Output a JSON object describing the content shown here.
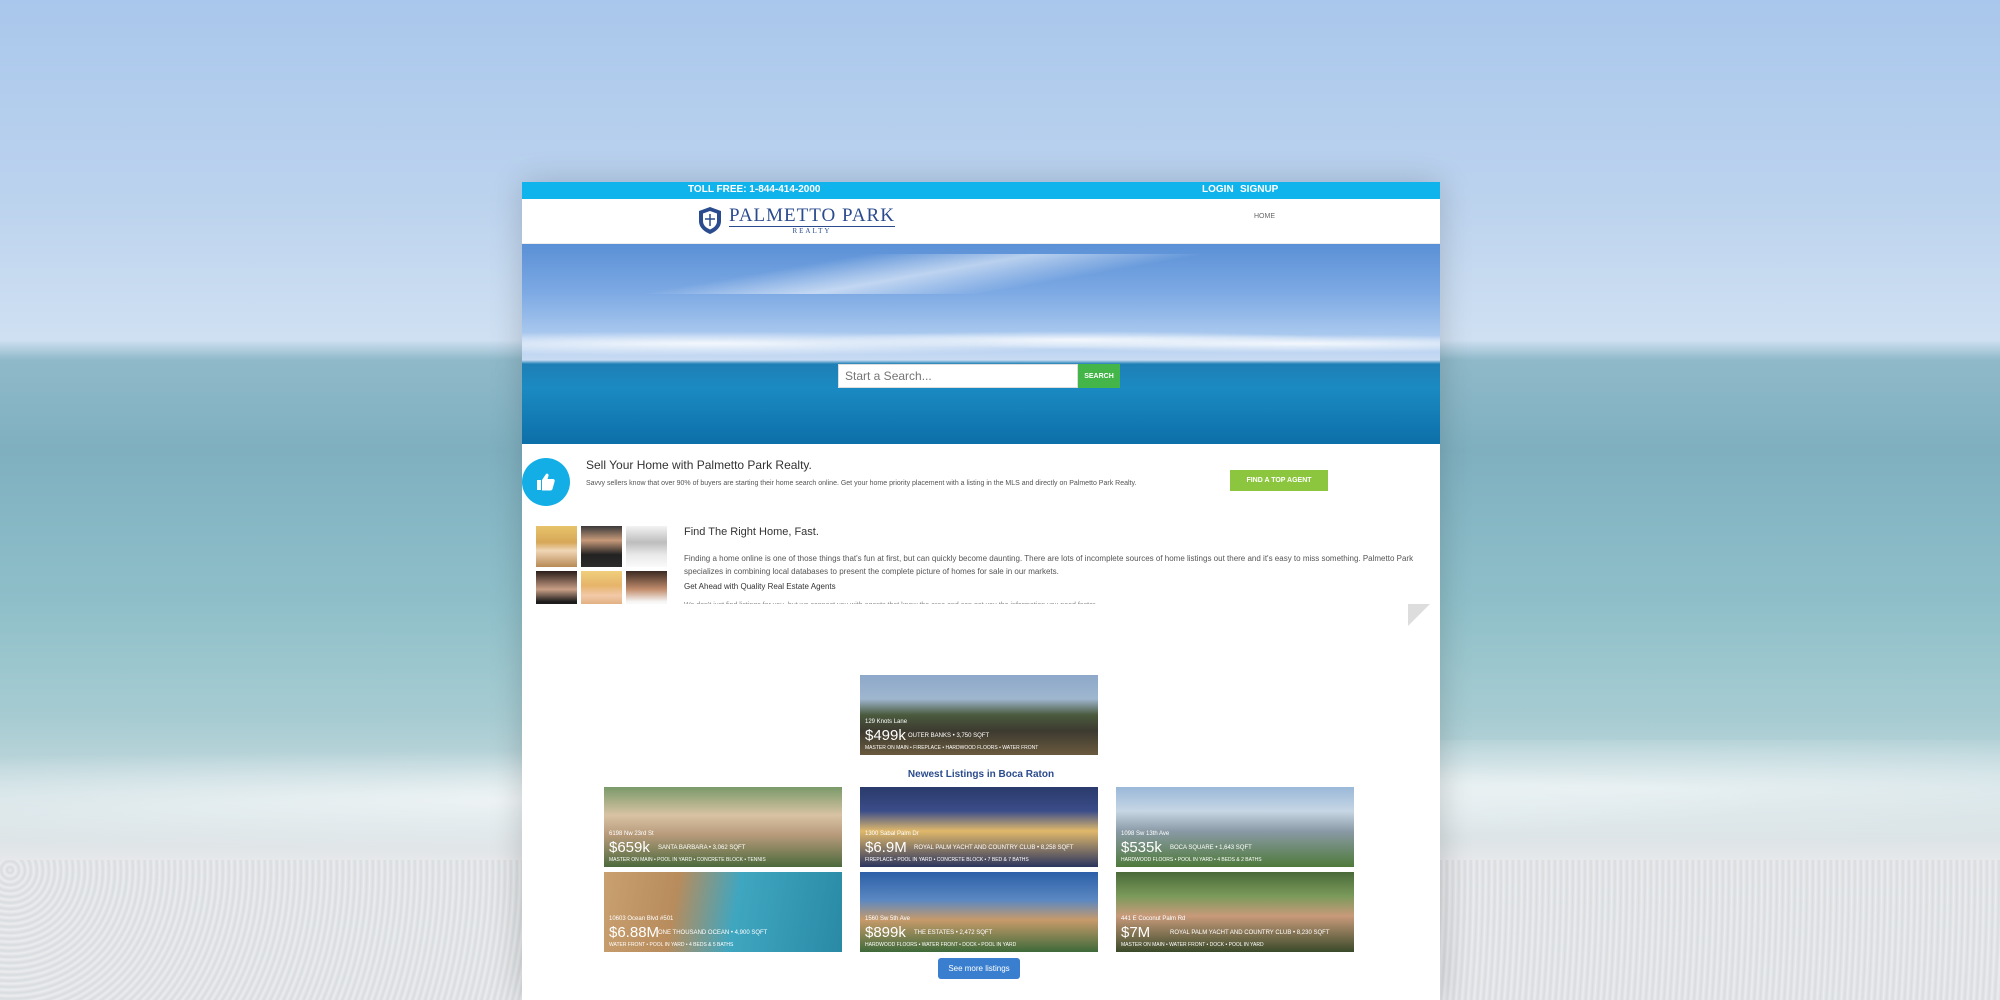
{
  "topbar": {
    "toll_free": "TOLL FREE: 1-844-414-2000",
    "login": "LOGIN",
    "signup": "SIGNUP"
  },
  "header": {
    "logo_main": "PALMETTO PARK",
    "logo_sub": "REALTY",
    "nav_home": "HOME"
  },
  "search": {
    "placeholder": "Start a Search...",
    "button": "SEARCH"
  },
  "sell": {
    "title": "Sell Your Home with Palmetto Park Realty.",
    "text": "Savvy sellers know that over 90% of buyers are starting their home search online. Get your home priority placement with a listing in the MLS and directly on Palmetto Park Realty.",
    "button": "FIND A TOP AGENT"
  },
  "find": {
    "title": "Find The Right Home, Fast.",
    "text": "Finding a home online is one of those things that's fun at first, but can quickly become daunting. There are lots of incomplete sources of home listings out there and it's easy to miss something. Palmetto Park specializes in combining local databases to present the complete picture of homes for sale in our markets.",
    "subtitle": "Get Ahead with Quality Real Estate Agents",
    "more": "We don't just find listings for you, but we connect you with agents that know the area and can get you the information you need faster."
  },
  "featured": {
    "addr": "129 Knots Lane",
    "price": "$499k",
    "meta": "OUTER BANKS • 3,750 SQFT",
    "feat": "MASTER ON MAIN • FIREPLACE • HARDWOOD FLOORS • WATER FRONT"
  },
  "newest_title": "Newest Listings in Boca Raton",
  "listings": [
    {
      "addr": "6198 Nw 23rd St",
      "price": "$659k",
      "meta": "SANTA BARBARA • 3,062 SQFT",
      "feat": "MASTER ON MAIN • POOL IN YARD • CONCRETE BLOCK • TENNIS"
    },
    {
      "addr": "1300 Sabal Palm Dr",
      "price": "$6.9M",
      "meta": "ROYAL PALM YACHT AND COUNTRY CLUB • 8,258 SQFT",
      "feat": "FIREPLACE • POOL IN YARD • CONCRETE BLOCK • 7 BED & 7 BATHS"
    },
    {
      "addr": "1098 Sw 13th Ave",
      "price": "$535k",
      "meta": "BOCA SQUARE • 1,643 SQFT",
      "feat": "HARDWOOD FLOORS • POOL IN YARD • 4 BEDS & 2 BATHS"
    },
    {
      "addr": "10603 Ocean Blvd #501",
      "price": "$6.88M",
      "meta": "ONE THOUSAND OCEAN • 4,900 SQFT",
      "feat": "WATER FRONT • POOL IN YARD • 4 BEDS & 5 BATHS"
    },
    {
      "addr": "1560 Sw 5th Ave",
      "price": "$899k",
      "meta": "THE ESTATES • 2,472 SQFT",
      "feat": "HARDWOOD FLOORS • WATER FRONT • DOCK • POOL IN YARD"
    },
    {
      "addr": "441 E Coconut Palm Rd",
      "price": "$7M",
      "meta": "ROYAL PALM YACHT AND COUNTRY CLUB • 8,230 SQFT",
      "feat": "MASTER ON MAIN • WATER FRONT • DOCK • POOL IN YARD"
    }
  ],
  "see_more": "See more listings",
  "icons": {
    "thumbs": "thumbs-up-icon",
    "crest": "crest-icon"
  },
  "colors": {
    "topbar": "#10b4ec",
    "search_button": "#43b549",
    "agent_button": "#8cc63f",
    "see_more": "#3a7fcf",
    "brand": "#2a4b8d"
  }
}
